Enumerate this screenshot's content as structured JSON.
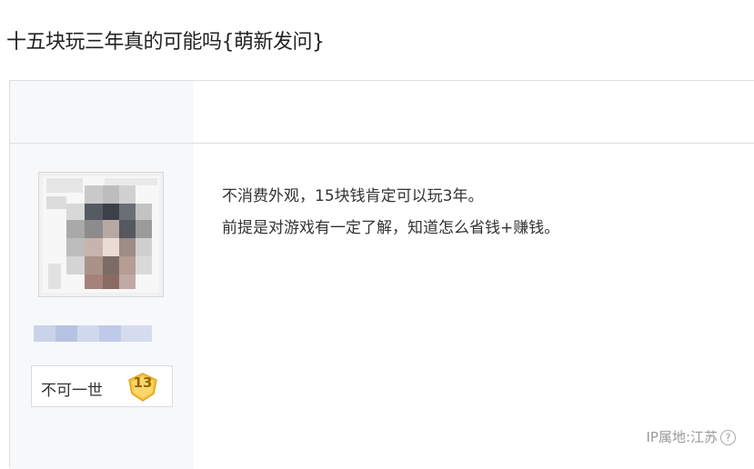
{
  "thread": {
    "title": "十五块玩三年真的可能吗{萌新发问}"
  },
  "post": {
    "author": {
      "avatar_icon": "avatar-pixelated",
      "level_name": "不可一世",
      "level_number": "13",
      "level_color": "#f5c342"
    },
    "content_lines": [
      "不消费外观，15块钱肯定可以玩3年。",
      "前提是对游戏有一定了解，知道怎么省钱+赚钱。"
    ],
    "ip_location": "IP属地:江苏",
    "help_icon": "help-circle-icon"
  },
  "colors": {
    "sidebar_bg": "#f7f8fa",
    "border": "#dedede",
    "muted_text": "#999999"
  }
}
